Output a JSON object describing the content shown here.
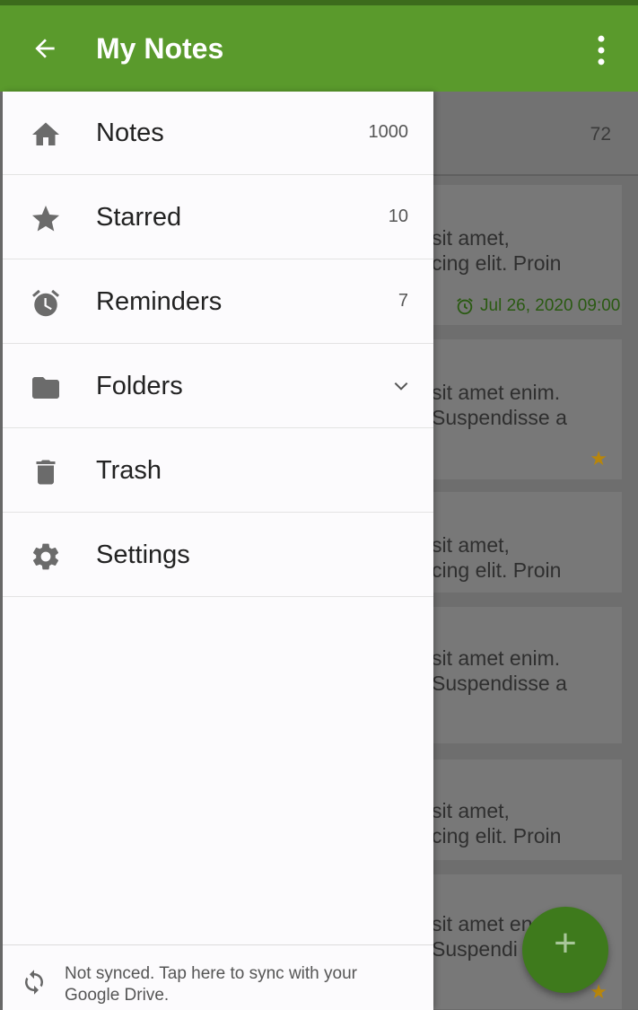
{
  "appbar": {
    "title": "My Notes"
  },
  "drawer": {
    "items": [
      {
        "label": "Notes",
        "count": "1000",
        "icon": "home-icon"
      },
      {
        "label": "Starred",
        "count": "10",
        "icon": "star-icon"
      },
      {
        "label": "Reminders",
        "count": "7",
        "icon": "alarm-icon"
      },
      {
        "label": "Folders",
        "icon": "folder-icon"
      },
      {
        "label": "Trash",
        "icon": "trash-icon"
      },
      {
        "label": "Settings",
        "icon": "gear-icon"
      }
    ],
    "sync_text": "Not synced. Tap here to sync with your Google Drive."
  },
  "background_list": {
    "header_count": "72",
    "cards": [
      {
        "line1": "sit amet,",
        "line2": "cing elit. Proin",
        "date": "Jul 26, 2020 09:00"
      },
      {
        "line1": "sit amet enim.",
        "line2": "Suspendisse a"
      },
      {
        "line1": "sit amet,",
        "line2": "cing elit. Proin"
      },
      {
        "line1": "sit amet enim.",
        "line2": "Suspendisse a"
      },
      {
        "line1": "sit amet,",
        "line2": "cing elit. Proin"
      },
      {
        "line1": "sit amet en",
        "line2": "Suspendi"
      }
    ]
  },
  "colors": {
    "primary": "#5a9a2c",
    "fab": "#3e7a1c",
    "star": "#b8860b"
  }
}
